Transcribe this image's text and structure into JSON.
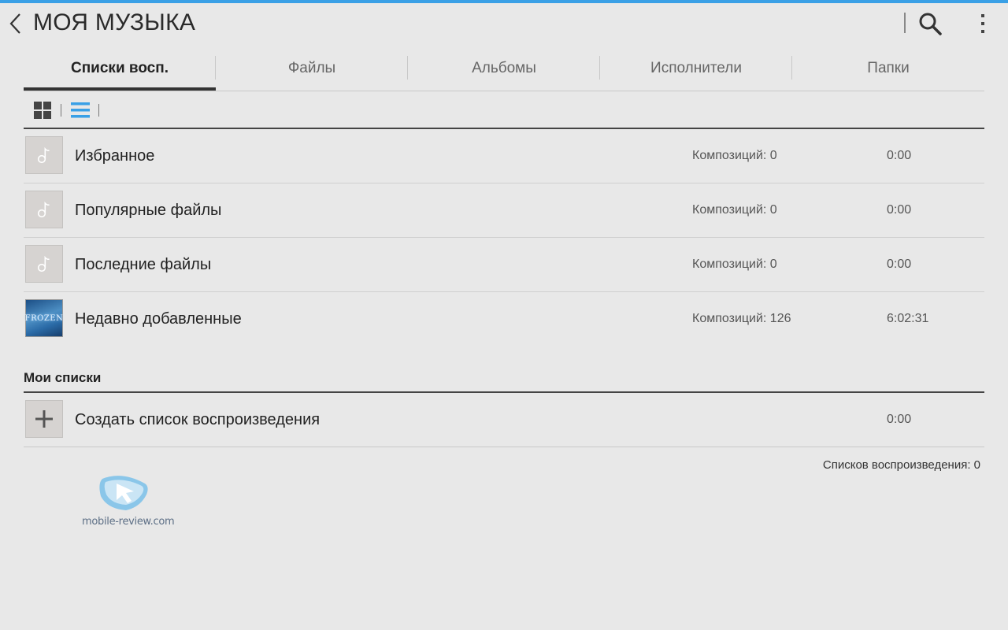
{
  "header": {
    "title": "МОЯ МУЗЫКА",
    "back_icon": "chevron-left-icon",
    "search_icon": "search-icon",
    "more_icon": "more-vert-icon"
  },
  "tabs": [
    {
      "label": "Списки восп.",
      "active": true
    },
    {
      "label": "Файлы",
      "active": false
    },
    {
      "label": "Альбомы",
      "active": false
    },
    {
      "label": "Исполнители",
      "active": false
    },
    {
      "label": "Папки",
      "active": false
    }
  ],
  "view_toggle": {
    "grid_icon": "grid-view-icon",
    "list_icon": "list-view-icon",
    "selected": "list"
  },
  "playlists": [
    {
      "name": "Избранное",
      "count": "Композиций: 0",
      "duration": "0:00",
      "thumb": "music-note-icon"
    },
    {
      "name": "Популярные файлы",
      "count": "Композиций: 0",
      "duration": "0:00",
      "thumb": "music-note-icon"
    },
    {
      "name": "Последние файлы",
      "count": "Композиций: 0",
      "duration": "0:00",
      "thumb": "music-note-icon"
    },
    {
      "name": "Недавно добавленные",
      "count": "Композиций: 126",
      "duration": "6:02:31",
      "thumb": "album-cover",
      "cover_text": "FROZEN"
    }
  ],
  "my_lists": {
    "title": "Мои списки",
    "create": {
      "name": "Создать список воспроизведения",
      "duration": "0:00",
      "icon": "plus-icon"
    },
    "footer": "Списков воспроизведения: 0"
  },
  "watermark": {
    "text": "mobile-review.com"
  },
  "colors": {
    "accent": "#3aa0e6",
    "background": "#e8e8e8",
    "text": "#222222",
    "thumb": "#d6d3d1"
  }
}
